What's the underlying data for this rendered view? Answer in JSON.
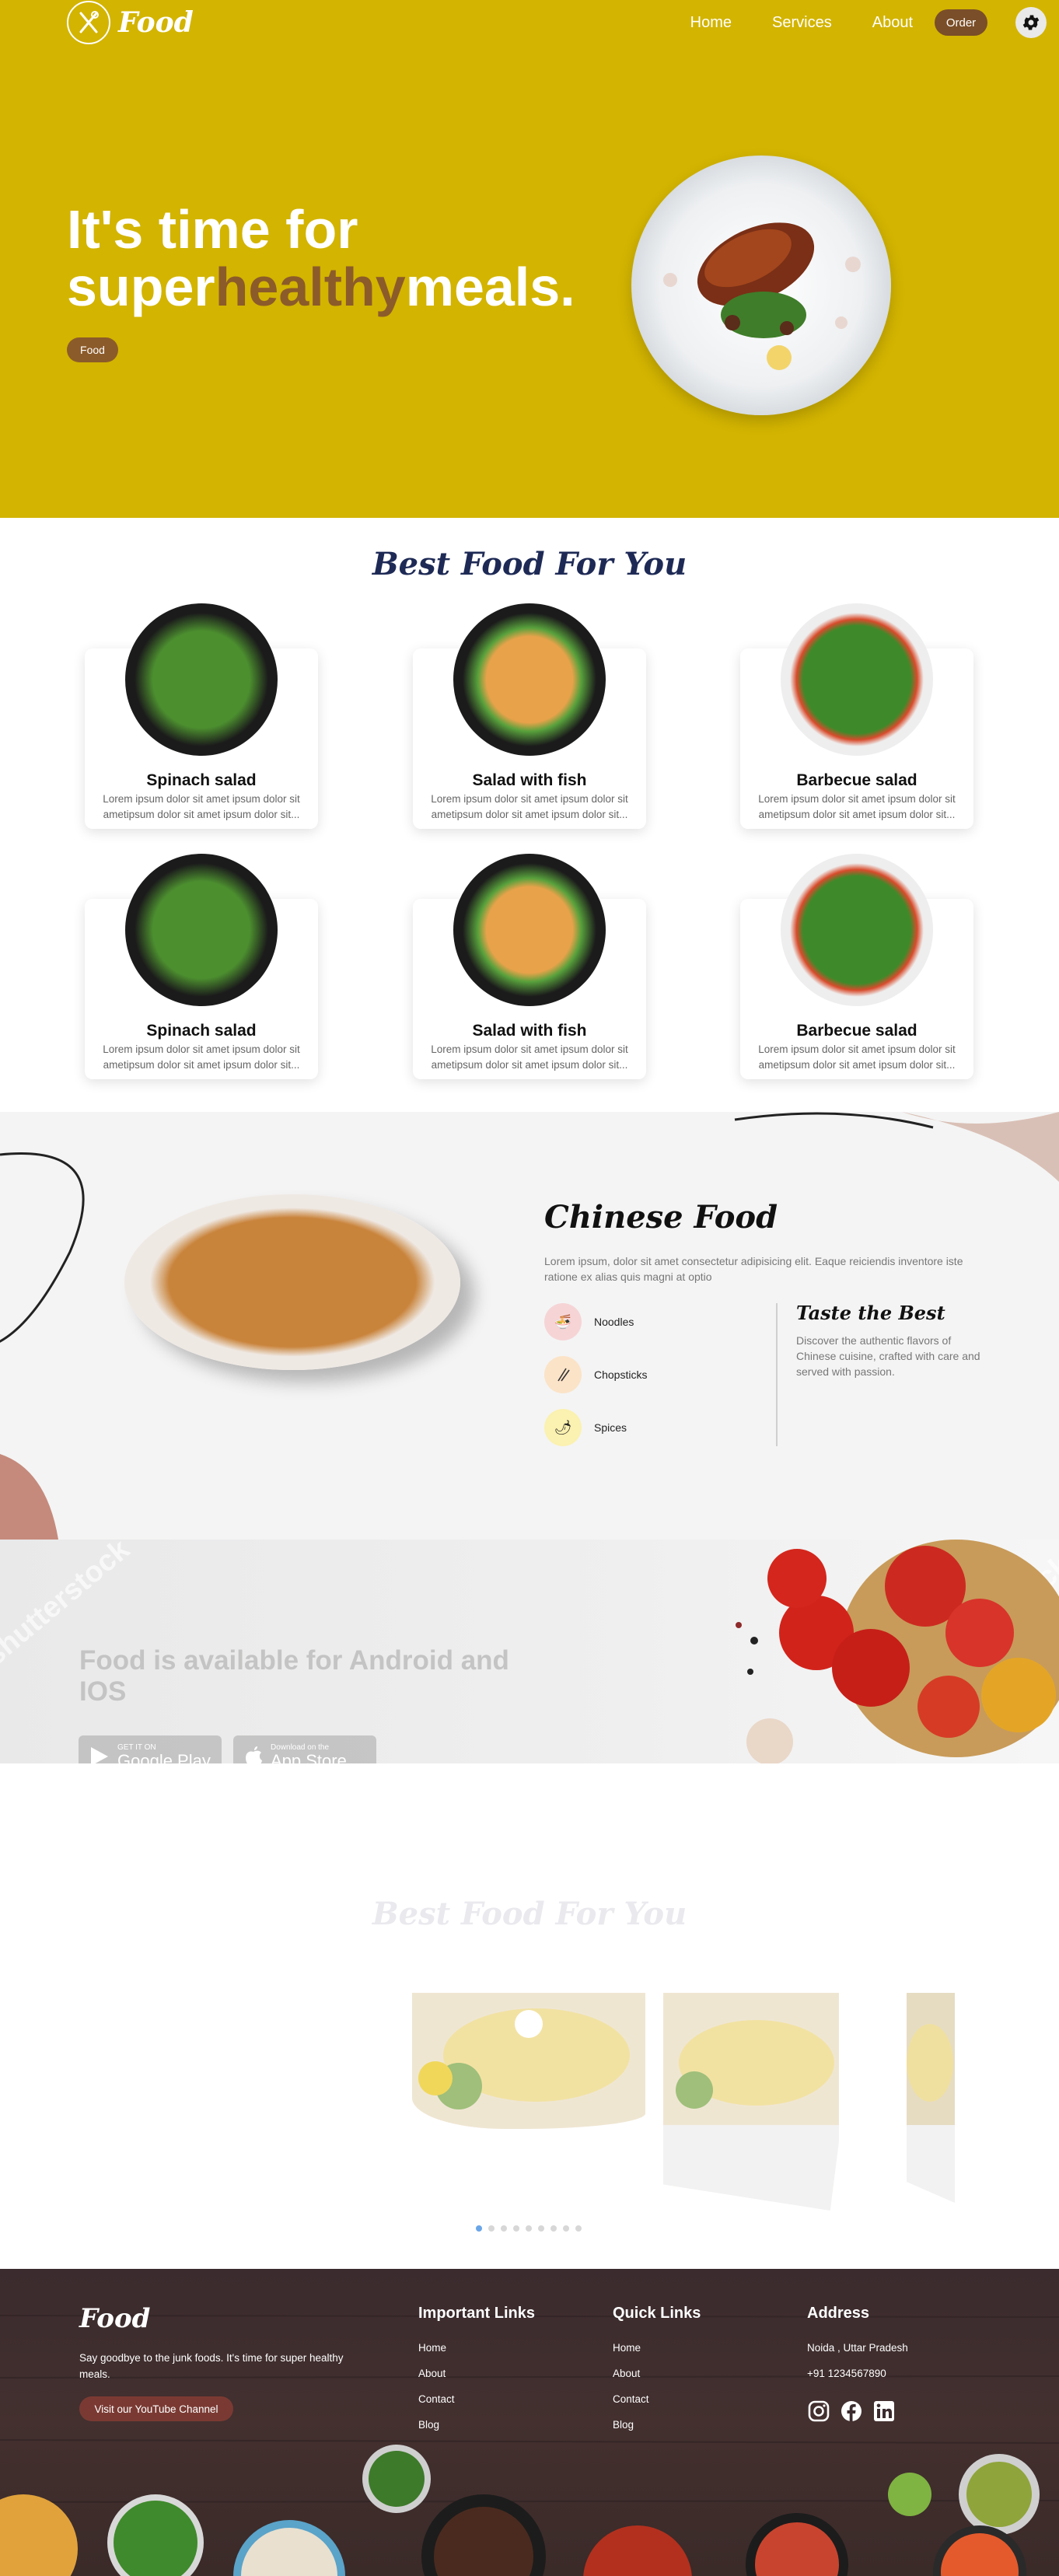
{
  "brand": {
    "logo": "Food"
  },
  "nav": {
    "items": [
      "Home",
      "Services",
      "About"
    ],
    "order_label": "Order"
  },
  "hero": {
    "line1": "It's time for",
    "super": "super",
    "accent": "healthy",
    "meals": "meals.",
    "tag": "Food"
  },
  "best_food": {
    "title": "Best Food For You",
    "cards": [
      {
        "title": "Spinach salad",
        "desc": "Lorem ipsum dolor sit amet ipsum dolor sit ametipsum dolor sit amet ipsum dolor sit..."
      },
      {
        "title": "Salad with fish",
        "desc": "Lorem ipsum dolor sit amet ipsum dolor sit ametipsum dolor sit amet ipsum dolor sit..."
      },
      {
        "title": "Barbecue salad",
        "desc": "Lorem ipsum dolor sit amet ipsum dolor sit ametipsum dolor sit amet ipsum dolor sit..."
      },
      {
        "title": "Spinach salad",
        "desc": "Lorem ipsum dolor sit amet ipsum dolor sit ametipsum dolor sit amet ipsum dolor sit..."
      },
      {
        "title": "Salad with fish",
        "desc": "Lorem ipsum dolor sit amet ipsum dolor sit ametipsum dolor sit amet ipsum dolor sit..."
      },
      {
        "title": "Barbecue salad",
        "desc": "Lorem ipsum dolor sit amet ipsum dolor sit ametipsum dolor sit amet ipsum dolor sit..."
      }
    ]
  },
  "chinese": {
    "title": "Chinese Food",
    "desc": "Lorem ipsum, dolor sit amet consectetur adipisicing elit. Eaque reiciendis inventore iste ratione ex alias quis magni at optio",
    "items": [
      "Noodles",
      "Chopsticks",
      "Spices"
    ],
    "sub_title": "Taste the Best",
    "sub_desc": "Discover the authentic flavors of Chinese cuisine, crafted with care and served with passion."
  },
  "app": {
    "title": "Food is available for Android and IOS",
    "google_small": "GET IT ON",
    "google_big": "Google Play",
    "apple_small": "Download on the",
    "apple_big": "App Store",
    "watermark": "shutterstock"
  },
  "slider": {
    "title": "Best Food For You",
    "dot_count": 9,
    "active_dot": 0
  },
  "footer": {
    "logo": "Food",
    "tagline": "Say goodbye to the junk foods. It's time for super healthy meals.",
    "youtube_label": "Visit our YouTube Channel",
    "important_title": "Important Links",
    "important_links": [
      "Home",
      "About",
      "Contact",
      "Blog"
    ],
    "quick_title": "Quick Links",
    "quick_links": [
      "Home",
      "About",
      "Contact",
      "Blog"
    ],
    "address_title": "Address",
    "address": "Noida , Uttar Pradesh",
    "phone": "+91 1234567890"
  },
  "colors": {
    "hero_bg": "#d3b400",
    "accent_brown": "#8c5b2a",
    "title_navy": "#1e2a55",
    "footer_bg": "#3b2b2e"
  }
}
